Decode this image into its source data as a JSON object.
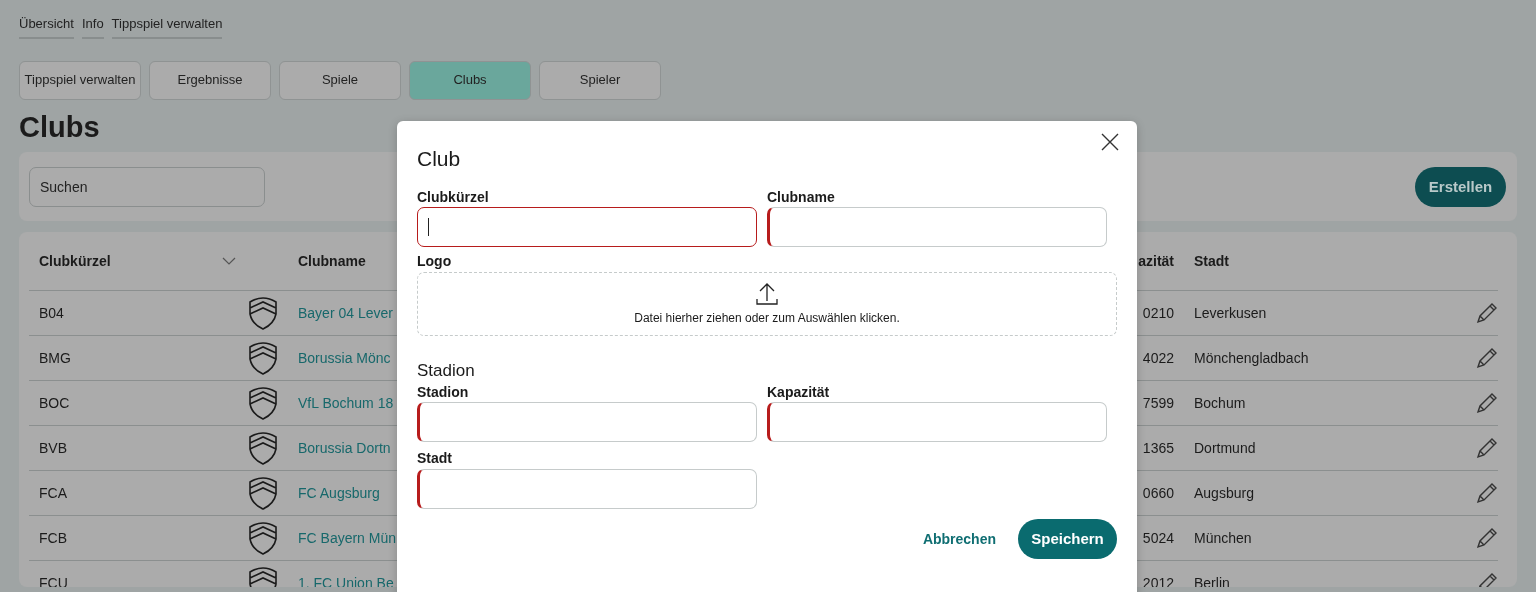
{
  "breadcrumbs": [
    {
      "label": "Übersicht"
    },
    {
      "label": "Info"
    },
    {
      "label": "Tippspiel verwalten"
    }
  ],
  "tabs": [
    {
      "label": "Tippspiel verwalten",
      "selected": false
    },
    {
      "label": "Ergebnisse",
      "selected": false
    },
    {
      "label": "Spiele",
      "selected": false
    },
    {
      "label": "Clubs",
      "selected": true
    },
    {
      "label": "Spieler",
      "selected": false
    }
  ],
  "page_title": "Clubs",
  "search": {
    "placeholder": "Suchen"
  },
  "create_button": "Erstellen",
  "table": {
    "columns": [
      {
        "label": "Clubkürzel",
        "sortable": true
      },
      {
        "label": "Clubname",
        "sortable": false
      },
      {
        "label": "azität",
        "sortable": false
      },
      {
        "label": "Stadt",
        "sortable": false
      }
    ],
    "rows": [
      {
        "code": "B04",
        "name": "Bayer 04 Lever",
        "capacity": "0210",
        "city": "Leverkusen"
      },
      {
        "code": "BMG",
        "name": "Borussia Mönc",
        "capacity": "4022",
        "city": "Mönchengladbach"
      },
      {
        "code": "BOC",
        "name": "VfL Bochum 18",
        "capacity": "7599",
        "city": "Bochum"
      },
      {
        "code": "BVB",
        "name": "Borussia Dortn",
        "capacity": "1365",
        "city": "Dortmund"
      },
      {
        "code": "FCA",
        "name": "FC Augsburg",
        "capacity": "0660",
        "city": "Augsburg"
      },
      {
        "code": "FCB",
        "name": "FC Bayern Mün",
        "capacity": "5024",
        "city": "München"
      },
      {
        "code": "FCU",
        "name": "1. FC Union Be",
        "capacity": "2012",
        "city": "Berlin"
      }
    ]
  },
  "dialog": {
    "title": "Club",
    "fields": [
      {
        "label": "Clubkürzel",
        "focused": true,
        "invalid": true
      },
      {
        "label": "Clubname",
        "focused": false,
        "invalid": true
      }
    ],
    "logo": {
      "label": "Logo",
      "hint": "Datei hierher ziehen oder zum Auswählen klicken."
    },
    "stadium": {
      "title": "Stadion",
      "fields": [
        {
          "label": "Stadion",
          "focused": false,
          "invalid": true
        },
        {
          "label": "Kapazität",
          "focused": false,
          "invalid": true
        },
        {
          "label": "Stadt",
          "focused": false,
          "invalid": true
        }
      ]
    },
    "cancel_button": "Abbrechen",
    "save_button": "Speichern"
  }
}
